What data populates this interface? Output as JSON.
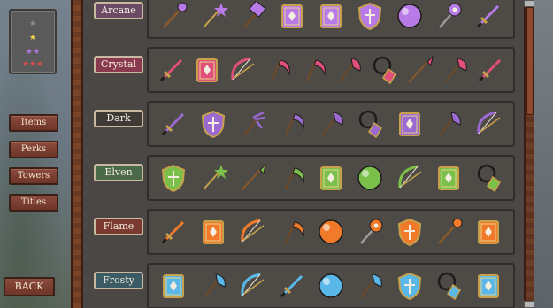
{
  "stars": {
    "rows": [
      {
        "glyph": "★",
        "color": "#8b8b8b"
      },
      {
        "glyph": "★",
        "color": "#f2d44a"
      },
      {
        "glyph": "★★",
        "color": "#b07ae0"
      },
      {
        "glyph": "★★★",
        "color": "#e04a4a"
      }
    ]
  },
  "menu": {
    "items": [
      "Items",
      "Perks",
      "Towers",
      "Titles"
    ],
    "back": "BACK"
  },
  "categories": [
    {
      "name": "Arcane",
      "label_bg": "#6b4a66",
      "accent": "#b77ae6",
      "icons": [
        "staff-icon",
        "wand-icon",
        "hammer-icon",
        "spellbook-icon",
        "spellbook-icon",
        "shield-icon",
        "orb-icon",
        "mace-icon",
        "sword-icon"
      ]
    },
    {
      "name": "Crystal",
      "label_bg": "#8a3a4e",
      "accent": "#e0507a",
      "icons": [
        "sword-icon",
        "spellbook-icon",
        "bow-icon",
        "scythe-icon",
        "scythe-icon",
        "axe-icon",
        "amulet-icon",
        "spear-icon",
        "axe-icon",
        "sword-icon"
      ]
    },
    {
      "name": "Dark",
      "label_bg": "#3e3a36",
      "accent": "#9a6ad0",
      "icons": [
        "sword-icon",
        "shield-icon",
        "trident-icon",
        "scythe-icon",
        "axe-icon",
        "amulet-icon",
        "spellbook-icon",
        "axe-icon",
        "bow-icon"
      ]
    },
    {
      "name": "Elven",
      "label_bg": "#4a6a4a",
      "accent": "#7ac04a",
      "icons": [
        "shield-icon",
        "wand-icon",
        "spear-icon",
        "scythe-icon",
        "spellbook-icon",
        "orb-icon",
        "bow-icon",
        "spellbook-icon",
        "amulet-icon"
      ]
    },
    {
      "name": "Flame",
      "label_bg": "#7a3a30",
      "accent": "#f07a2a",
      "icons": [
        "sword-icon",
        "spellbook-icon",
        "bow-icon",
        "scythe-icon",
        "orb-icon",
        "mace-icon",
        "shield-icon",
        "staff-icon",
        "spellbook-icon"
      ]
    },
    {
      "name": "Frosty",
      "label_bg": "#3a5a64",
      "accent": "#5ab8e8",
      "icons": [
        "spellbook-icon",
        "axe-icon",
        "bow-icon",
        "sword-icon",
        "orb-icon",
        "axe-icon",
        "shield-icon",
        "amulet-icon",
        "spellbook-icon"
      ]
    }
  ]
}
